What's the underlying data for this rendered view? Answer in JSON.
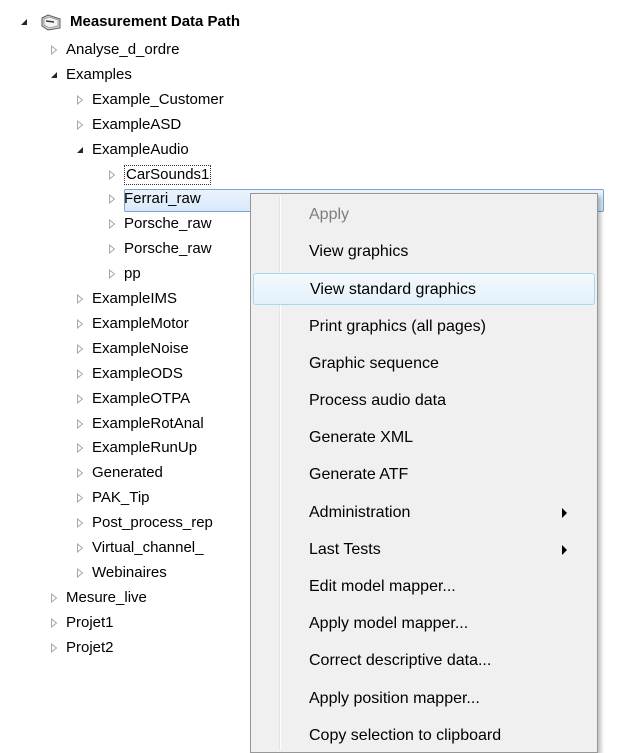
{
  "tree": {
    "root": {
      "label": "Measurement Data Path"
    },
    "items": [
      {
        "label": "Analyse_d_ordre",
        "level": 1,
        "expanded": false
      },
      {
        "label": "Examples",
        "level": 1,
        "expanded": true
      },
      {
        "label": "Example_Customer",
        "level": 2,
        "expanded": false
      },
      {
        "label": "ExampleASD",
        "level": 2,
        "expanded": false
      },
      {
        "label": "ExampleAudio",
        "level": 2,
        "expanded": true
      },
      {
        "label": "CarSounds1",
        "level": 3,
        "expanded": false,
        "selected": true
      },
      {
        "label": "Ferrari_raw",
        "level": 3,
        "expanded": false
      },
      {
        "label": "Porsche_raw",
        "level": 3,
        "expanded": false
      },
      {
        "label": "Porsche_raw",
        "level": 3,
        "expanded": false
      },
      {
        "label": "pp",
        "level": 3,
        "expanded": false
      },
      {
        "label": "ExampleIMS",
        "level": 2,
        "expanded": false
      },
      {
        "label": "ExampleMotor",
        "level": 2,
        "expanded": false
      },
      {
        "label": "ExampleNoise",
        "level": 2,
        "expanded": false
      },
      {
        "label": "ExampleODS",
        "level": 2,
        "expanded": false
      },
      {
        "label": "ExampleOTPA",
        "level": 2,
        "expanded": false
      },
      {
        "label": "ExampleRotAnal",
        "level": 2,
        "expanded": false
      },
      {
        "label": "ExampleRunUp",
        "level": 2,
        "expanded": false
      },
      {
        "label": "Generated",
        "level": 2,
        "expanded": false
      },
      {
        "label": "PAK_Tip",
        "level": 2,
        "expanded": false
      },
      {
        "label": "Post_process_rep",
        "level": 2,
        "expanded": false
      },
      {
        "label": "Virtual_channel_",
        "level": 2,
        "expanded": false
      },
      {
        "label": "Webinaires",
        "level": 2,
        "expanded": false
      },
      {
        "label": "Mesure_live",
        "level": 1,
        "expanded": false
      },
      {
        "label": "Projet1",
        "level": 1,
        "expanded": false
      },
      {
        "label": "Projet2",
        "level": 1,
        "expanded": false
      }
    ]
  },
  "context_menu": {
    "items": [
      {
        "label": "Apply",
        "disabled": true
      },
      {
        "label": "View graphics"
      },
      {
        "label": "View standard graphics",
        "highlighted": true
      },
      {
        "label": "Print graphics (all pages)"
      },
      {
        "label": "Graphic sequence"
      },
      {
        "label": "Process audio data"
      },
      {
        "label": "Generate XML"
      },
      {
        "label": "Generate ATF"
      },
      {
        "label": "Administration",
        "submenu": true
      },
      {
        "label": "Last Tests",
        "submenu": true
      },
      {
        "label": "Edit model mapper..."
      },
      {
        "label": "Apply model mapper..."
      },
      {
        "label": "Correct descriptive data..."
      },
      {
        "label": "Apply position mapper..."
      },
      {
        "label": "Copy selection to clipboard"
      }
    ]
  },
  "colors": {
    "selection_border": "#7da2ce",
    "menu_background": "#f0f0f0",
    "menu_highlight_border": "#a8d8eb",
    "disabled_text": "#7d7d7d"
  },
  "icons": {
    "root_icon": "folder-network-icon",
    "collapsed": "triangle-right-outline-icon",
    "expanded": "triangle-down-filled-icon",
    "submenu": "submenu-arrow-icon"
  }
}
